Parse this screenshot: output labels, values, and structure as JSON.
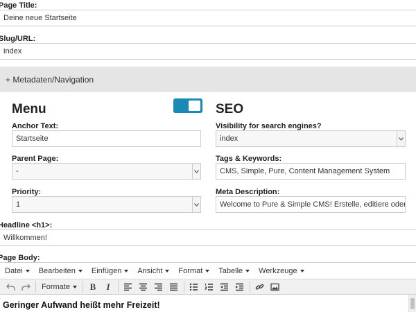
{
  "page_title": {
    "label": "Page Title:",
    "value": "Deine neue Startseite"
  },
  "slug": {
    "label": "Slug/URL:",
    "value": "index"
  },
  "metadata_toggle": "+ Metadaten/Navigation",
  "menu": {
    "heading": "Menu",
    "toggle_on": true,
    "anchor_text": {
      "label": "Anchor Text:",
      "value": "Startseite"
    },
    "parent_page": {
      "label": "Parent Page:",
      "value": "-"
    },
    "priority": {
      "label": "Priority:",
      "value": "1"
    }
  },
  "seo": {
    "heading": "SEO",
    "visibility": {
      "label": "Visibility for search engines?",
      "value": "index"
    },
    "tags": {
      "label": "Tags & Keywords:",
      "value": "CMS, Simple, Pure, Content Management System"
    },
    "meta_description": {
      "label": "Meta Description:",
      "value": "Welcome to Pure & Simple CMS! Erstelle, editiere oder lösche su"
    }
  },
  "headline": {
    "label": "Headline <h1>:",
    "value": "Willkommen!"
  },
  "page_body": {
    "label": "Page Body:",
    "menubar": [
      "Datei",
      "Bearbeiten",
      "Einfügen",
      "Ansicht",
      "Format",
      "Tabelle",
      "Werkzeuge"
    ],
    "formats_label": "Formate",
    "bold_glyph": "B",
    "italic_glyph": "I",
    "content_heading": "Geringer Aufwand heißt mehr Freizeit!"
  },
  "colors": {
    "accent": "#1a8ab5",
    "panel": "#e5e5e5"
  },
  "icons": [
    "undo-icon",
    "redo-icon",
    "align-left-icon",
    "align-center-icon",
    "align-right-icon",
    "align-justify-icon",
    "bullet-list-icon",
    "numbered-list-icon",
    "outdent-icon",
    "indent-icon",
    "link-icon",
    "image-icon",
    "chevron-down-icon"
  ]
}
